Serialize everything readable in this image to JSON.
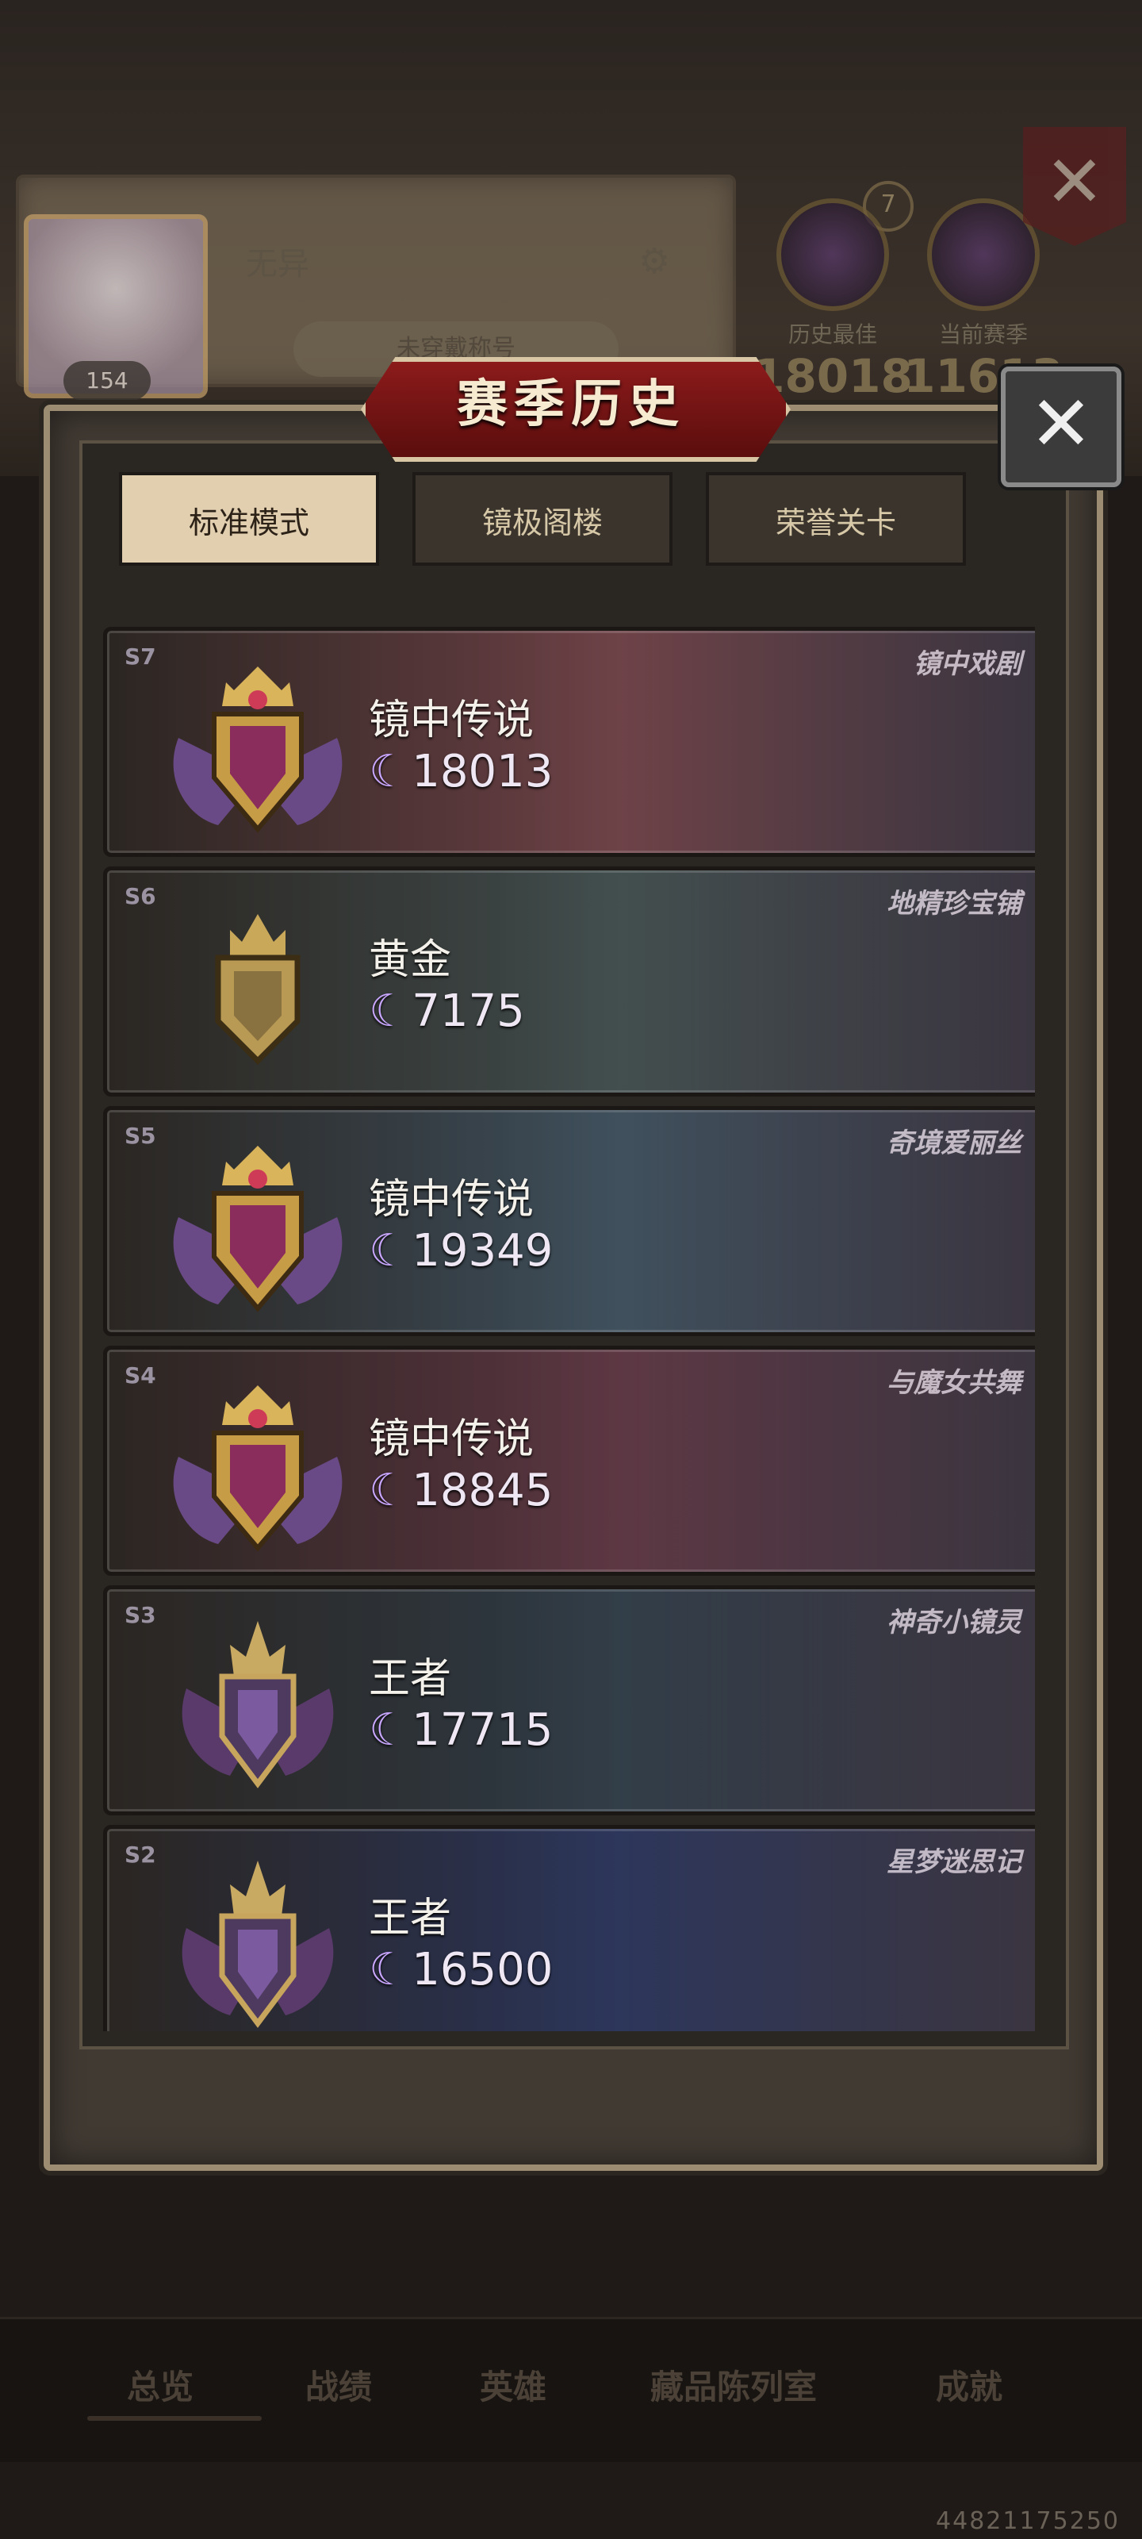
{
  "profile": {
    "name": "无异",
    "level": "154",
    "title_placeholder": "未穿戴称号",
    "history_best_label": "历史最佳",
    "history_best_value": "18018",
    "current_season_label": "当前赛季",
    "current_season_value": "11613",
    "rank_count": "7"
  },
  "dialog": {
    "title": "赛季历史",
    "close_icon": "close-icon",
    "tabs": [
      {
        "label": "标准模式",
        "active": true
      },
      {
        "label": "镜极阁楼",
        "active": false
      },
      {
        "label": "荣誉关卡",
        "active": false
      }
    ]
  },
  "seasons": [
    {
      "tag": "S7",
      "name": "镜中传说",
      "score": "18013",
      "card_title": "镜中戏剧",
      "emblem": "legend",
      "color": "#6b3f44"
    },
    {
      "tag": "S6",
      "name": "黄金",
      "score": "7175",
      "card_title": "地精珍宝铺",
      "emblem": "gold",
      "color": "#3f4b4b"
    },
    {
      "tag": "S5",
      "name": "镜中传说",
      "score": "19349",
      "card_title": "奇境爱丽丝",
      "emblem": "legend",
      "color": "#3c4d5a"
    },
    {
      "tag": "S4",
      "name": "镜中传说",
      "score": "18845",
      "card_title": "与魔女共舞",
      "emblem": "legend",
      "color": "#5a3440"
    },
    {
      "tag": "S3",
      "name": "王者",
      "score": "17715",
      "card_title": "神奇小镜灵",
      "emblem": "king",
      "color": "#2e3a45"
    },
    {
      "tag": "S2",
      "name": "王者",
      "score": "16500",
      "card_title": "星梦迷思记",
      "emblem": "king",
      "color": "#293358"
    }
  ],
  "nav": {
    "items": [
      "总览",
      "战绩",
      "英雄",
      "藏品陈列室",
      "成就"
    ]
  },
  "watermark": "44821175250"
}
